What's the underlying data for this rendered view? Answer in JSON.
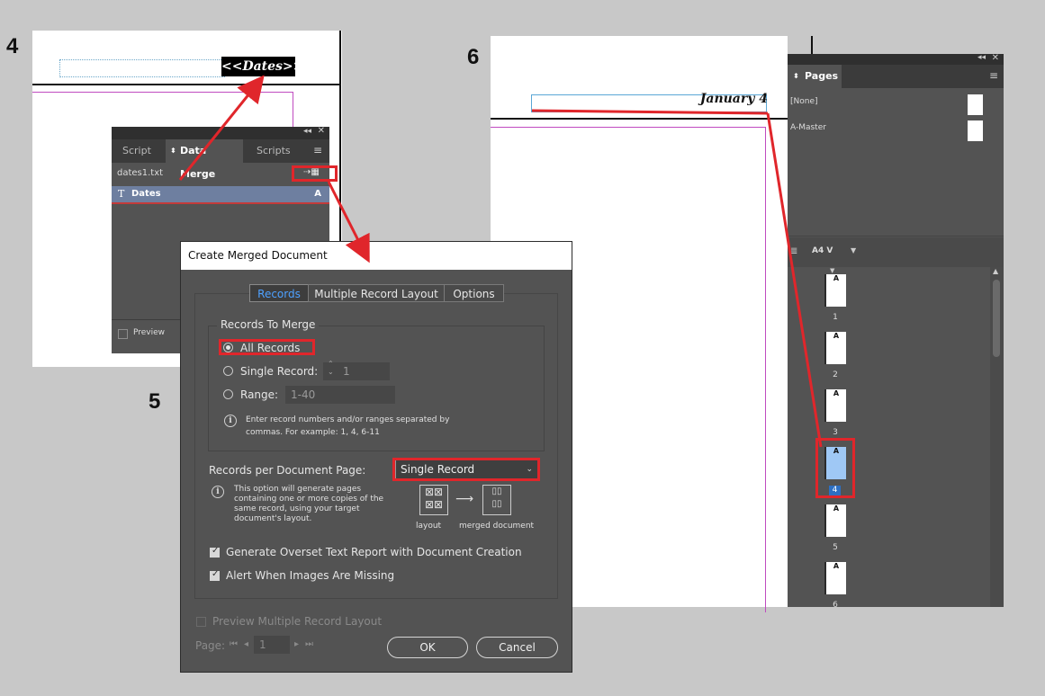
{
  "steps": {
    "s4": "4",
    "s5": "5",
    "s6": "6"
  },
  "doc4": {
    "field_text": "<<Dates>>"
  },
  "data_merge_panel": {
    "tabs": [
      "Script La",
      "Data Merge",
      "Scripts"
    ],
    "active_tab": "Data Merge",
    "source_file": "dates1.txt",
    "fields": [
      {
        "label": "Dates",
        "type_glyph": "A"
      }
    ],
    "preview_label": "Preview"
  },
  "dialog": {
    "title": "Create Merged Document",
    "tabs": [
      "Records",
      "Multiple Record Layout",
      "Options"
    ],
    "active_tab": "Records",
    "records_group_title": "Records To Merge",
    "options": {
      "all_records": "All Records",
      "single_record": "Single Record:",
      "single_record_value": "1",
      "range": "Range:",
      "range_placeholder": "1-40"
    },
    "range_hint": "Enter record numbers and/or ranges separated by commas. For example: 1, 4, 6-11",
    "rpp_label": "Records per Document Page:",
    "rpp_value": "Single Record",
    "rpp_hint": "This option will generate pages containing one or more copies of the same record, using your target document's layout.",
    "diagram_label_layout": "layout",
    "diagram_label_merged": "merged document",
    "check_overset": "Generate Overset Text Report with Document Creation",
    "check_images": "Alert When Images Are Missing",
    "preview_multi": "Preview Multiple Record Layout",
    "page_label": "Page:",
    "page_value": "1",
    "ok_label": "OK",
    "cancel_label": "Cancel"
  },
  "doc6": {
    "date_text": "January 4"
  },
  "pages_panel": {
    "title": "Pages",
    "masters": [
      "[None]",
      "A-Master"
    ],
    "size_label": "A4 V",
    "pages": [
      {
        "num": "1",
        "master": "A"
      },
      {
        "num": "2",
        "master": "A"
      },
      {
        "num": "3",
        "master": "A"
      },
      {
        "num": "4",
        "master": "A"
      },
      {
        "num": "5",
        "master": "A"
      },
      {
        "num": "6",
        "master": "A"
      }
    ],
    "selected_page": "4"
  },
  "colors": {
    "annotation_red": "#e0262b",
    "selection_blue": "#9fc8f5",
    "panel_bg": "#535353"
  }
}
